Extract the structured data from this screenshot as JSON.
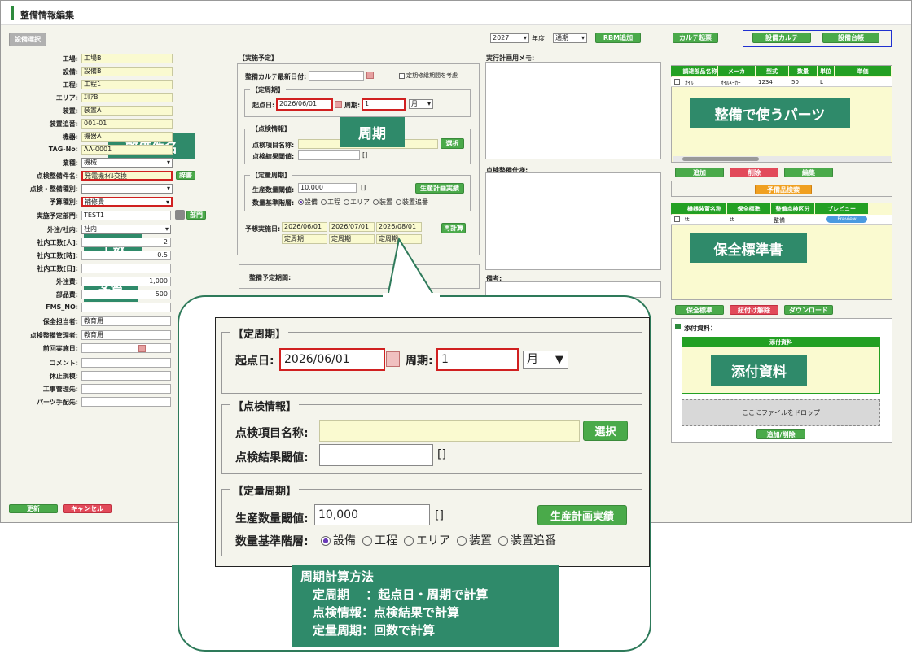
{
  "app": {
    "title": "整備情報編集"
  },
  "left": {
    "select_button": "設備選択",
    "fields": [
      {
        "label": "工場:",
        "value": "工場B"
      },
      {
        "label": "設備:",
        "value": "設備B"
      },
      {
        "label": "工程:",
        "value": "工程1"
      },
      {
        "label": "エリア:",
        "value": "ｴﾘｱB"
      },
      {
        "label": "装置:",
        "value": "装置A"
      },
      {
        "label": "装置追番:",
        "value": "001-01"
      },
      {
        "label": "機器:",
        "value": "機器A"
      },
      {
        "label": "TAG-No:",
        "value": "AA-0001"
      },
      {
        "label": "業種:",
        "value": "機械"
      },
      {
        "label": "点検整備件名:",
        "value": "発電機ｵｲﾙ交換"
      },
      {
        "label": "点検・整備種別:",
        "value": ""
      },
      {
        "label": "予算種別:",
        "value": "補修費"
      },
      {
        "label": "実施予定部門:",
        "value": "TEST1"
      },
      {
        "label": "外注/社内:",
        "value": "社内"
      },
      {
        "label": "社内工数[人]:",
        "value": "2"
      },
      {
        "label": "社内工数[時]:",
        "value": "0.5"
      },
      {
        "label": "社内工数[日]:",
        "value": ""
      },
      {
        "label": "外注費:",
        "value": "1,000"
      },
      {
        "label": "部品費:",
        "value": "500"
      },
      {
        "label": "FMS_NO:",
        "value": ""
      },
      {
        "label": "保全担当者:",
        "value": "教育用"
      },
      {
        "label": "点検整備管理者:",
        "value": "教育用"
      },
      {
        "label": "前回実施日:",
        "value": ""
      },
      {
        "label": "コメント:",
        "value": ""
      },
      {
        "label": "休止規模:",
        "value": ""
      },
      {
        "label": "工事管理先:",
        "value": ""
      },
      {
        "label": "パーツ手配先:",
        "value": ""
      }
    ],
    "jisho": "辞書",
    "bumon": "部門",
    "update": "更新",
    "cancel": "キャンセル"
  },
  "mid": {
    "section": "【実施予定】",
    "karte_date_label": "整備カルテ最新日付:",
    "consider_label": "定期修繕期間を考慮",
    "teishuki": "【定周期】",
    "start_label": "起点日:",
    "start_value": "2026/06/01",
    "period_label": "周期:",
    "period_value": "1",
    "unit": "月",
    "tenken": "【点検情報】",
    "item_label": "点検項目名称:",
    "select_btn": "選択",
    "result_label": "点検結果閾値:",
    "teiryo": "【定量周期】",
    "prod_label": "生産数量閾値:",
    "prod_value": "10,000",
    "prod_btn": "生産計画実績",
    "level_label": "数量基準階層:",
    "levels": [
      "設備",
      "工程",
      "エリア",
      "装置",
      "装置追番"
    ],
    "forecast_label": "予想実施日:",
    "forecast_dates": [
      "2026/06/01",
      "2026/07/01",
      "2026/08/01"
    ],
    "forecast_types": [
      "定周期",
      "定周期",
      "定周期"
    ],
    "recalc": "再計算",
    "period_plan_label": "整備予定期間:"
  },
  "memo": {
    "plan": "実行計画用メモ:",
    "spec": "点検整備仕様:",
    "note": "備考:"
  },
  "top": {
    "year": "2027",
    "year_label": "年度",
    "mode": "通期",
    "rbm": "RBM追加",
    "karte_create": "カルテ起票",
    "karte": "設備カルテ",
    "ledger": "設備台帳"
  },
  "parts": {
    "headers": [
      "調達部品名称",
      "メーカ",
      "型式",
      "数量",
      "単位",
      "単価"
    ],
    "rows": [
      [
        "ｵｲﾙ",
        "ｵｲﾙﾒｰｶｰ",
        "1234",
        "50",
        "L",
        ""
      ]
    ],
    "add": "追加",
    "del": "削除",
    "edit": "編集",
    "search": "予備品検索"
  },
  "std": {
    "headers": [
      "機器装置名称",
      "保全標準",
      "整備点検区分",
      "プレビュー"
    ],
    "rows": [
      [
        "tt",
        "tt",
        "整備",
        "Preview"
      ]
    ],
    "btn_std": "保全標準",
    "btn_unlink": "紐付け解除",
    "btn_dl": "ダウンロード"
  },
  "attach": {
    "title": "添付資料：",
    "header": "添付資料",
    "drop": "ここにファイルをドロップ",
    "btn": "追加/削除"
  },
  "callouts": {
    "name": "整備件名",
    "period": "周期",
    "kousu": "工数",
    "yosan": "予算",
    "parts": "整備で使うパーツ",
    "std": "保全標準書",
    "attach": "添付資料"
  },
  "note": [
    "周期計算方法",
    "　定周期　 ：起点日・周期で計算",
    "　点検情報：点検結果で計算",
    "　定量周期：回数で計算"
  ]
}
